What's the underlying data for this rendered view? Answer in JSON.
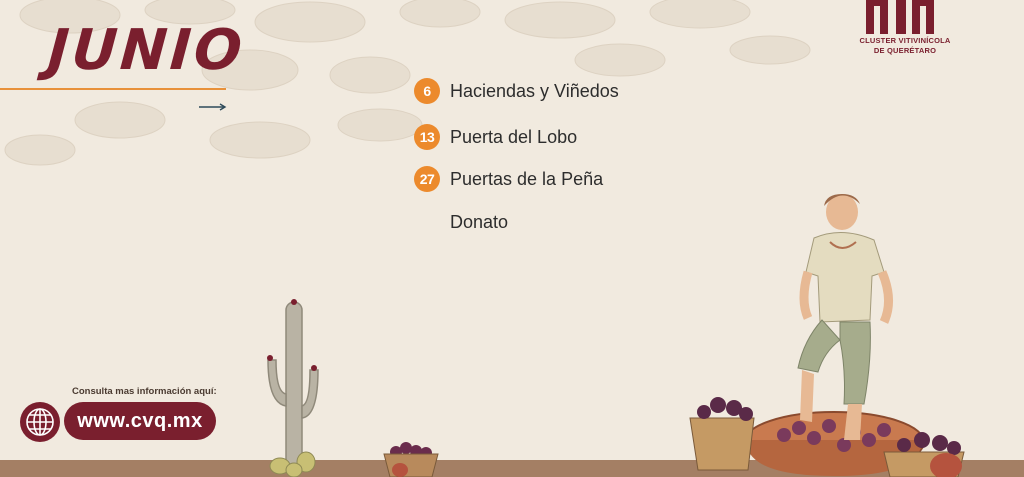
{
  "header": {
    "month": "JUNIO",
    "logo_line1": "CLUSTER VITIVINÍCOLA",
    "logo_line2": "DE QUERÉTARO"
  },
  "events": [
    {
      "day": "6",
      "label": "Haciendas y Viñedos"
    },
    {
      "day": "13",
      "label": "Puerta del Lobo"
    },
    {
      "day": "27",
      "label": "Puertas de la Peña"
    },
    {
      "day": "",
      "label": "Donato"
    }
  ],
  "footer": {
    "info_text": "Consulta mas información aquí:",
    "url": "www.cvq.mx",
    "icon": "globe-icon"
  },
  "colors": {
    "background": "#f1eadf",
    "brand": "#7a1f2e",
    "accent": "#ec8a2c",
    "ground": "#a47f64"
  }
}
